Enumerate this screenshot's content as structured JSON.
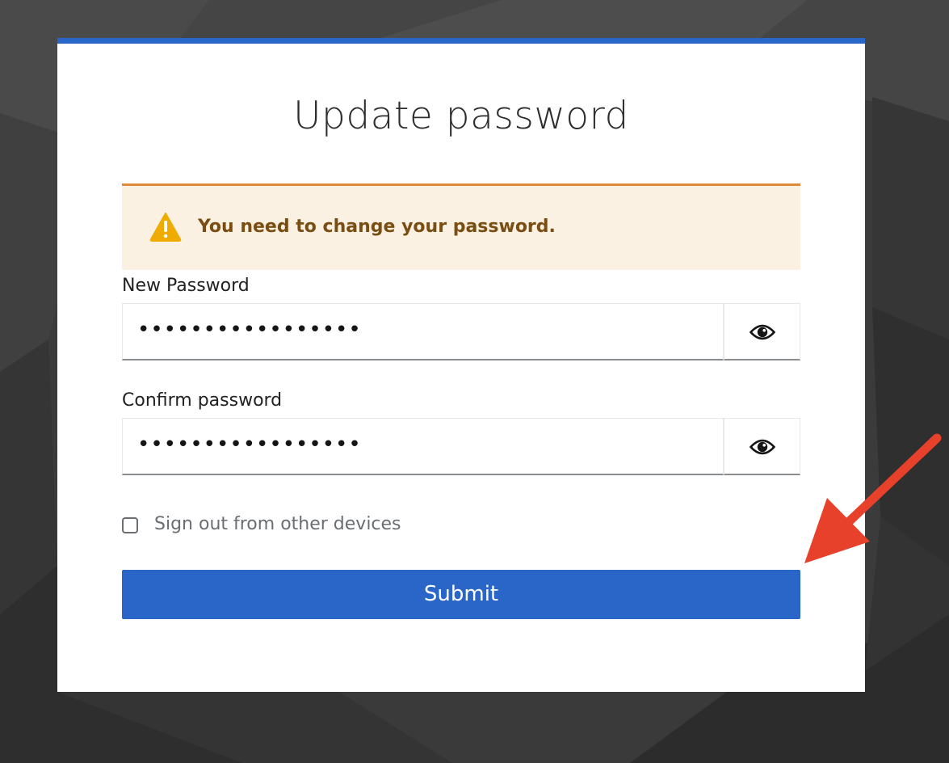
{
  "colors": {
    "accent": "#2a66c8",
    "warning_border": "#de8a3a",
    "warning_bg": "#fbf1e2",
    "warning_text": "#7a4e12",
    "annotation_arrow": "#e8412b"
  },
  "page": {
    "title": "Update password"
  },
  "alert": {
    "icon": "warning-triangle-icon",
    "message": "You need to change your password."
  },
  "new_password": {
    "label": "New Password",
    "value": "•••••••••••••••••",
    "toggle_icon": "eye-icon"
  },
  "confirm_password": {
    "label": "Confirm password",
    "value": "•••••••••••••••••",
    "toggle_icon": "eye-icon"
  },
  "sign_out": {
    "label": "Sign out from other devices",
    "checked": false
  },
  "submit": {
    "label": "Submit"
  }
}
